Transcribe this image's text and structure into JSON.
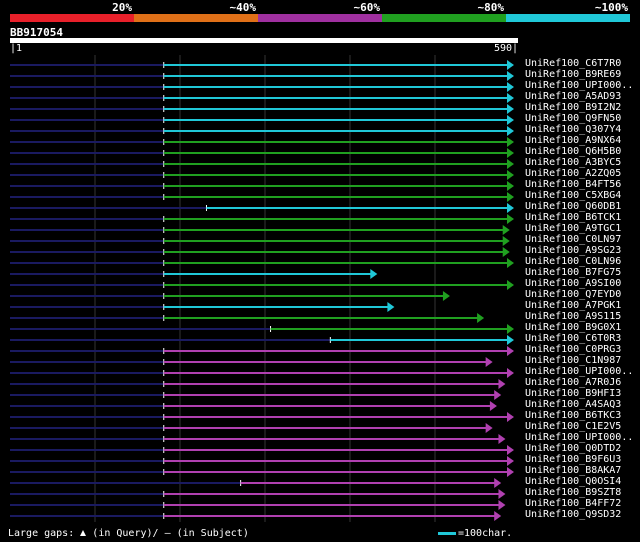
{
  "legend": {
    "labels": [
      "20%",
      "~40%",
      "~60%",
      "~80%",
      "~100%"
    ],
    "colors": [
      "#e8202a",
      "#e07018",
      "#a030a0",
      "#20a020",
      "#20c8d8"
    ]
  },
  "query": {
    "name": "BB917054",
    "start_label": "|1",
    "end_label": "590|",
    "length": 590
  },
  "hits": [
    {
      "label": "UniRef100_C6T7R0",
      "start": 180,
      "end": 590,
      "color": "cyan"
    },
    {
      "label": "UniRef100_B9RE69",
      "start": 180,
      "end": 590,
      "color": "cyan"
    },
    {
      "label": "UniRef100_UPI000..",
      "start": 180,
      "end": 590,
      "color": "cyan"
    },
    {
      "label": "UniRef100_A5AD93",
      "start": 180,
      "end": 590,
      "color": "cyan"
    },
    {
      "label": "UniRef100_B9I2N2",
      "start": 180,
      "end": 590,
      "color": "cyan"
    },
    {
      "label": "UniRef100_Q9FN50",
      "start": 180,
      "end": 590,
      "color": "cyan"
    },
    {
      "label": "UniRef100_Q307Y4",
      "start": 180,
      "end": 590,
      "color": "cyan"
    },
    {
      "label": "UniRef100_A9NX64",
      "start": 180,
      "end": 590,
      "color": "green"
    },
    {
      "label": "UniRef100_Q6H5B0",
      "start": 180,
      "end": 590,
      "color": "green"
    },
    {
      "label": "UniRef100_A3BYC5",
      "start": 180,
      "end": 590,
      "color": "green"
    },
    {
      "label": "UniRef100_A2ZQ05",
      "start": 180,
      "end": 590,
      "color": "green"
    },
    {
      "label": "UniRef100_B4FT56",
      "start": 180,
      "end": 590,
      "color": "green"
    },
    {
      "label": "UniRef100_C5XBG4",
      "start": 180,
      "end": 590,
      "color": "green"
    },
    {
      "label": "UniRef100_Q60DB1",
      "start": 230,
      "end": 590,
      "color": "cyan"
    },
    {
      "label": "UniRef100_B6TCK1",
      "start": 180,
      "end": 590,
      "color": "green"
    },
    {
      "label": "UniRef100_A9TGC1",
      "start": 180,
      "end": 585,
      "color": "green"
    },
    {
      "label": "UniRef100_C0LN97",
      "start": 180,
      "end": 585,
      "color": "green"
    },
    {
      "label": "UniRef100_A9SG23",
      "start": 180,
      "end": 585,
      "color": "green"
    },
    {
      "label": "UniRef100_C0LN96",
      "start": 180,
      "end": 590,
      "color": "green"
    },
    {
      "label": "UniRef100_B7FG75",
      "start": 180,
      "end": 430,
      "color": "cyan"
    },
    {
      "label": "UniRef100_A9SI00",
      "start": 180,
      "end": 590,
      "color": "green"
    },
    {
      "label": "UniRef100_Q7EYD0",
      "start": 180,
      "end": 515,
      "color": "green"
    },
    {
      "label": "UniRef100_A7PGK1",
      "start": 180,
      "end": 450,
      "color": "cyan"
    },
    {
      "label": "UniRef100_A9S115",
      "start": 180,
      "end": 555,
      "color": "green"
    },
    {
      "label": "UniRef100_B9G0X1",
      "start": 305,
      "end": 590,
      "color": "green"
    },
    {
      "label": "UniRef100_C6T0R3",
      "start": 375,
      "end": 590,
      "color": "cyan"
    },
    {
      "label": "UniRef100_C0PRG3",
      "start": 180,
      "end": 590,
      "color": "magenta"
    },
    {
      "label": "UniRef100_C1N987",
      "start": 180,
      "end": 565,
      "color": "magenta"
    },
    {
      "label": "UniRef100_UPI000..",
      "start": 180,
      "end": 590,
      "color": "magenta"
    },
    {
      "label": "UniRef100_A7R0J6",
      "start": 180,
      "end": 580,
      "color": "magenta"
    },
    {
      "label": "UniRef100_B9HFI3",
      "start": 180,
      "end": 575,
      "color": "magenta"
    },
    {
      "label": "UniRef100_A4SAQ3",
      "start": 180,
      "end": 570,
      "color": "magenta"
    },
    {
      "label": "UniRef100_B6TKC3",
      "start": 180,
      "end": 590,
      "color": "magenta"
    },
    {
      "label": "UniRef100_C1E2V5",
      "start": 180,
      "end": 565,
      "color": "magenta"
    },
    {
      "label": "UniRef100_UPI000..",
      "start": 180,
      "end": 580,
      "color": "magenta"
    },
    {
      "label": "UniRef100_Q0DTD2",
      "start": 180,
      "end": 590,
      "color": "magenta"
    },
    {
      "label": "UniRef100_B9F6U3",
      "start": 180,
      "end": 590,
      "color": "magenta"
    },
    {
      "label": "UniRef100_B8AKA7",
      "start": 180,
      "end": 590,
      "color": "magenta"
    },
    {
      "label": "UniRef100_Q0OSI4",
      "start": 270,
      "end": 575,
      "color": "magenta"
    },
    {
      "label": "UniRef100_B9SZT8",
      "start": 180,
      "end": 580,
      "color": "magenta"
    },
    {
      "label": "UniRef100_B4FF72",
      "start": 180,
      "end": 580,
      "color": "magenta"
    },
    {
      "label": "UniRef100_Q9SD32",
      "start": 180,
      "end": 575,
      "color": "magenta"
    }
  ],
  "footer": {
    "large_gaps_prefix": "Large gaps:",
    "in_query": "(in Query)/",
    "in_subject": "– (in Subject)",
    "scale_text": "=100char."
  }
}
